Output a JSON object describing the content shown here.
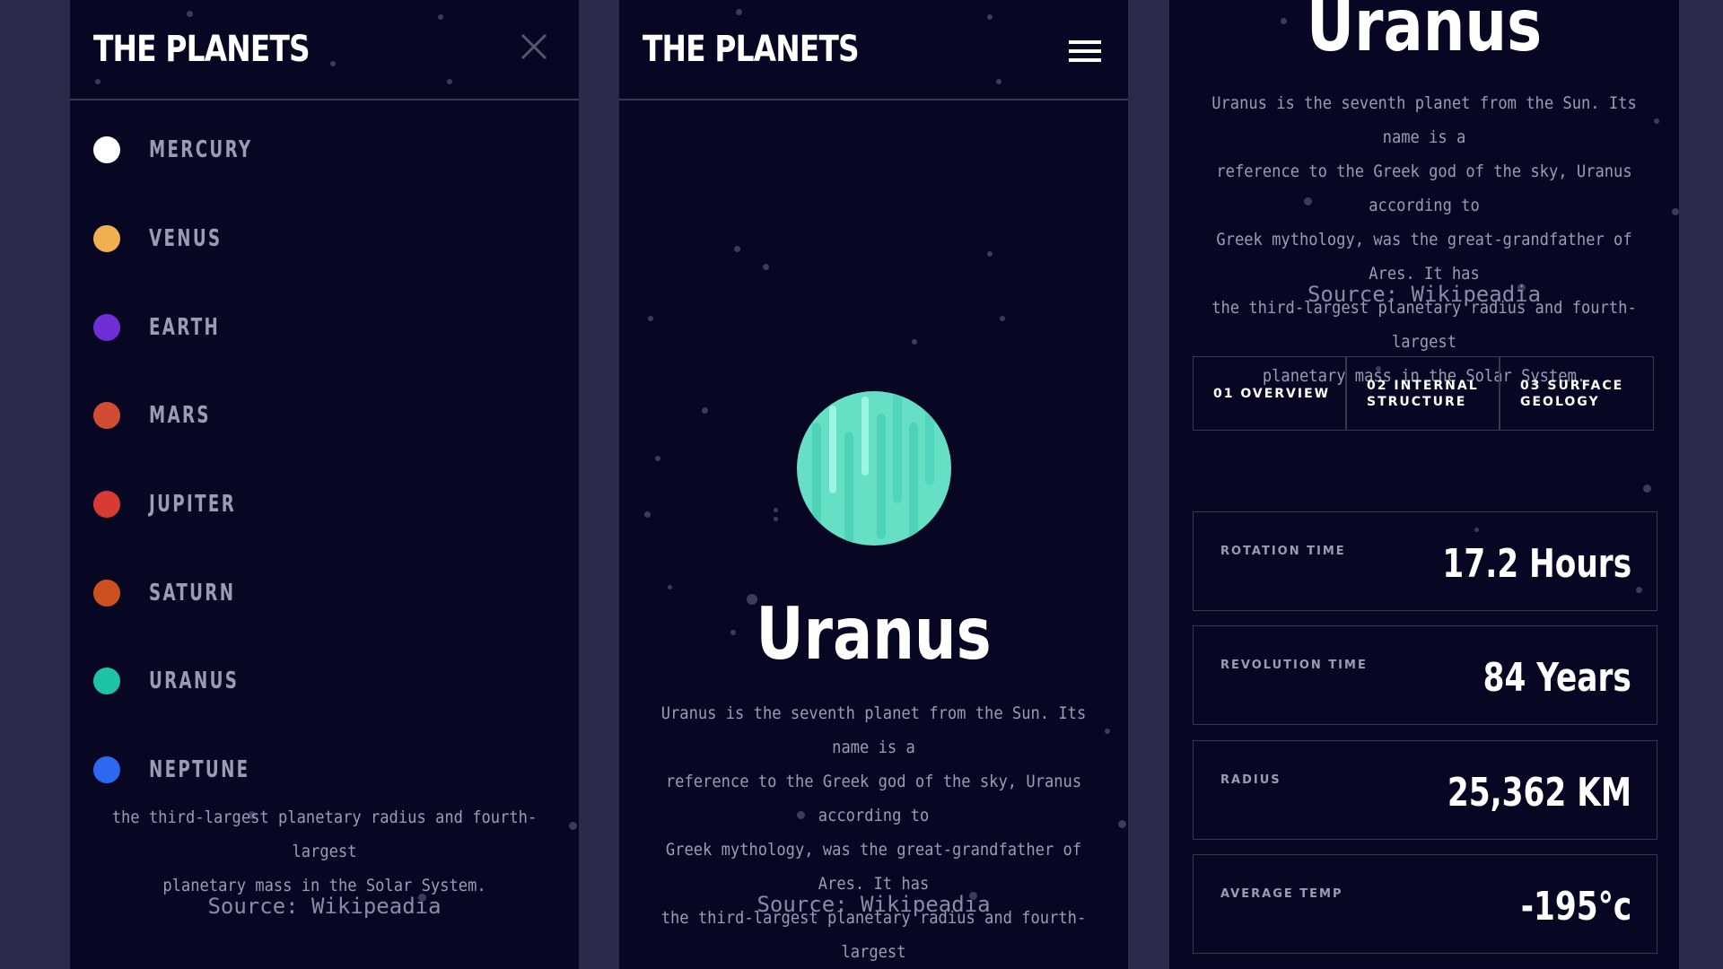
{
  "app": {
    "logo": "THE PLANETS"
  },
  "menu": {
    "items": [
      {
        "label": "MERCURY",
        "color": "#ffffff"
      },
      {
        "label": "VENUS",
        "color": "#f1b04f"
      },
      {
        "label": "EARTH",
        "color": "#6f2ed6"
      },
      {
        "label": "MARS",
        "color": "#d14c32"
      },
      {
        "label": "JUPITER",
        "color": "#d83a34"
      },
      {
        "label": "SATURN",
        "color": "#cd5120"
      },
      {
        "label": "URANUS",
        "color": "#1ec2a4"
      },
      {
        "label": "NEPTUNE",
        "color": "#2d68f0"
      }
    ]
  },
  "planet": {
    "name": "Uranus",
    "description": "Uranus is the seventh planet from the Sun. Its name is a reference to the Greek god of the sky, Uranus according to Greek mythology, was the great-grandfather of Ares. It has the third-largest planetary radius and fourth-largest planetary mass in the Solar System.",
    "description_lines": [
      "Uranus is the seventh planet from the Sun. Its name is a",
      "reference to the Greek god of the sky, Uranus according to",
      "Greek mythology, was the great-grandfather of Ares. It has",
      "the third-largest planetary radius and fourth-largest",
      "planetary mass in the Solar System."
    ],
    "source": "Source: Wikipeadia",
    "accent_color": "#1ec2a4"
  },
  "tabs": [
    {
      "line1": "01 OVERVIEW",
      "line2": ""
    },
    {
      "line1": "02 INTERNAL",
      "line2": "STRUCTURE"
    },
    {
      "line1": "03 SURFACE",
      "line2": "GEOLOGY"
    }
  ],
  "stats": [
    {
      "label": "ROTATION TIME",
      "value": "17.2 Hours"
    },
    {
      "label": "REVOLUTION TIME",
      "value": "84 Years"
    },
    {
      "label": "RADIUS",
      "value": "25,362 KM"
    },
    {
      "label": "AVERAGE TEMP",
      "value": "-195°c"
    }
  ],
  "colors": {
    "background": "#070724",
    "frame": "#2a2b4b",
    "divider": "#38384f",
    "muted_text": "#9c9cb0"
  },
  "icons": {
    "close": "close-icon",
    "menu": "hamburger-icon",
    "planet": "uranus-planet-icon"
  }
}
